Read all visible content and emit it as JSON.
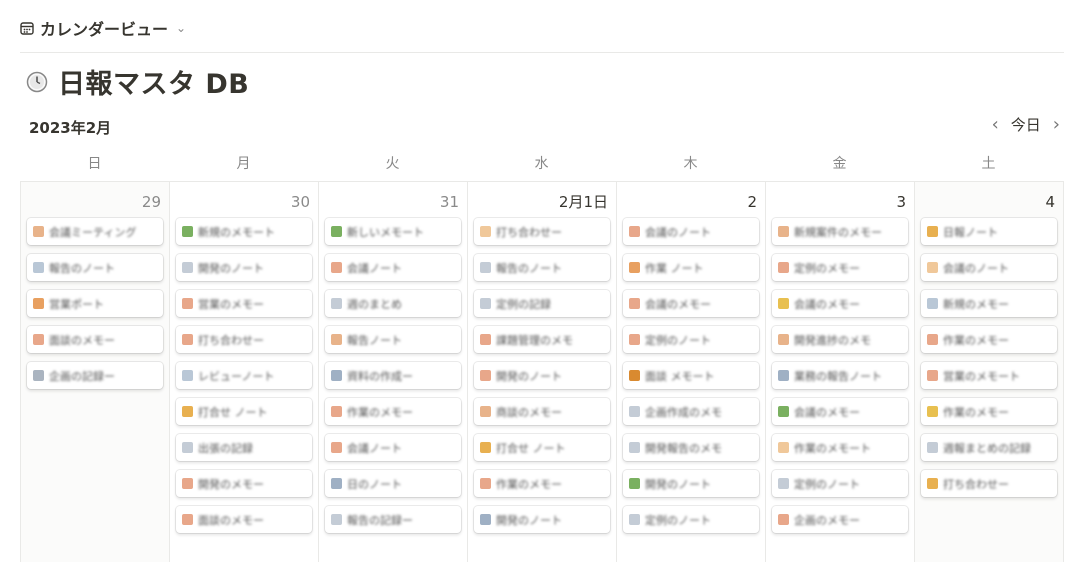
{
  "view": {
    "label": "カレンダービュー",
    "icon": "calendar-icon"
  },
  "page": {
    "title": "日報マスタ DB",
    "icon": "clock-icon"
  },
  "calendar": {
    "month_label": "2023年2月",
    "today_label": "今日",
    "weekdays": [
      "日",
      "月",
      "火",
      "水",
      "木",
      "金",
      "土"
    ],
    "days": [
      {
        "label": "29",
        "prev": true,
        "weekend": true,
        "cards": [
          {
            "t": "会議ミーティング",
            "c": "#e8b38a"
          },
          {
            "t": "報告のノート",
            "c": "#b9c7d6"
          },
          {
            "t": "営業ポート",
            "c": "#e8a060"
          },
          {
            "t": "面談のメモー",
            "c": "#e8a78a"
          },
          {
            "t": "企画の記録ー",
            "c": "#aab4c0"
          }
        ]
      },
      {
        "label": "30",
        "prev": true,
        "weekend": false,
        "cards": [
          {
            "t": "新規のメモート",
            "c": "#7ab060"
          },
          {
            "t": "開発のノート",
            "c": "#c4ccd6"
          },
          {
            "t": "営業のメモー",
            "c": "#e8a78a"
          },
          {
            "t": "打ち合わせー",
            "c": "#e8a78a"
          },
          {
            "t": "レビューノート",
            "c": "#b9c7d6"
          },
          {
            "t": "打合せ ノート",
            "c": "#e8b050"
          },
          {
            "t": "出張の記録",
            "c": "#c4ccd6"
          },
          {
            "t": "開発のメモー",
            "c": "#e8a78a"
          },
          {
            "t": "面談のメモー",
            "c": "#e8a78a"
          }
        ]
      },
      {
        "label": "31",
        "prev": true,
        "weekend": false,
        "cards": [
          {
            "t": "新しいメモート",
            "c": "#7ab060"
          },
          {
            "t": "会議ノート",
            "c": "#e8a78a"
          },
          {
            "t": "週のまとめ",
            "c": "#c4ccd6"
          },
          {
            "t": "報告ノート",
            "c": "#e8b38a"
          },
          {
            "t": "資料の作成ー",
            "c": "#9fb0c4"
          },
          {
            "t": "作業のメモー",
            "c": "#e8a78a"
          },
          {
            "t": "会議ノート",
            "c": "#e8a78a"
          },
          {
            "t": "日のノート",
            "c": "#9fb0c4"
          },
          {
            "t": "報告の記録ー",
            "c": "#c4ccd6"
          }
        ]
      },
      {
        "label": "2月1日",
        "prev": false,
        "weekend": false,
        "cards": [
          {
            "t": "打ち合わせー",
            "c": "#f0c89a"
          },
          {
            "t": "報告のノート",
            "c": "#c4ccd6"
          },
          {
            "t": "定例の記録",
            "c": "#c4ccd6"
          },
          {
            "t": "課題管理のメモ",
            "c": "#e8a78a"
          },
          {
            "t": "開発のノート",
            "c": "#e8a78a"
          },
          {
            "t": "商談のメモー",
            "c": "#e8b38a"
          },
          {
            "t": "打合せ ノート",
            "c": "#e8b050"
          },
          {
            "t": "作業のメモー",
            "c": "#e8a78a"
          },
          {
            "t": "開発のノート",
            "c": "#9fb0c4"
          }
        ]
      },
      {
        "label": "2",
        "prev": false,
        "weekend": false,
        "cards": [
          {
            "t": "会議のノート",
            "c": "#e8a78a"
          },
          {
            "t": "作業 ノート",
            "c": "#e8a060"
          },
          {
            "t": "会議のメモー",
            "c": "#e8a78a"
          },
          {
            "t": "定例のノート",
            "c": "#e8a78a"
          },
          {
            "t": "面談 メモート",
            "c": "#d98a30"
          },
          {
            "t": "企画作成のメモ",
            "c": "#c4ccd6"
          },
          {
            "t": "開発報告のメモ",
            "c": "#c4ccd6"
          },
          {
            "t": "開発のノート",
            "c": "#7ab060"
          },
          {
            "t": "定例のノート",
            "c": "#c4ccd6"
          }
        ]
      },
      {
        "label": "3",
        "prev": false,
        "weekend": false,
        "cards": [
          {
            "t": "新規案件のメモー",
            "c": "#e8b38a"
          },
          {
            "t": "定例のメモー",
            "c": "#e8a78a"
          },
          {
            "t": "会議のメモー",
            "c": "#e8c050"
          },
          {
            "t": "開発進捗のメモ",
            "c": "#e8b38a"
          },
          {
            "t": "業務の報告ノート",
            "c": "#9fb0c4"
          },
          {
            "t": "会議のメモー",
            "c": "#7ab060"
          },
          {
            "t": "作業のメモート",
            "c": "#f0c89a"
          },
          {
            "t": "定例のノート",
            "c": "#c4ccd6"
          },
          {
            "t": "企画のメモー",
            "c": "#e8a78a"
          }
        ]
      },
      {
        "label": "4",
        "prev": false,
        "weekend": true,
        "cards": [
          {
            "t": "日報ノート",
            "c": "#e8b050"
          },
          {
            "t": "会議のノート",
            "c": "#f0c89a"
          },
          {
            "t": "新規のメモー",
            "c": "#b9c7d6"
          },
          {
            "t": "作業のメモー",
            "c": "#e8a78a"
          },
          {
            "t": "営業のメモート",
            "c": "#e8a78a"
          },
          {
            "t": "作業のメモー",
            "c": "#e8c050"
          },
          {
            "t": "週報まとめの記録",
            "c": "#c4ccd6"
          },
          {
            "t": "打ち合わせー",
            "c": "#e8b050"
          }
        ]
      }
    ]
  }
}
